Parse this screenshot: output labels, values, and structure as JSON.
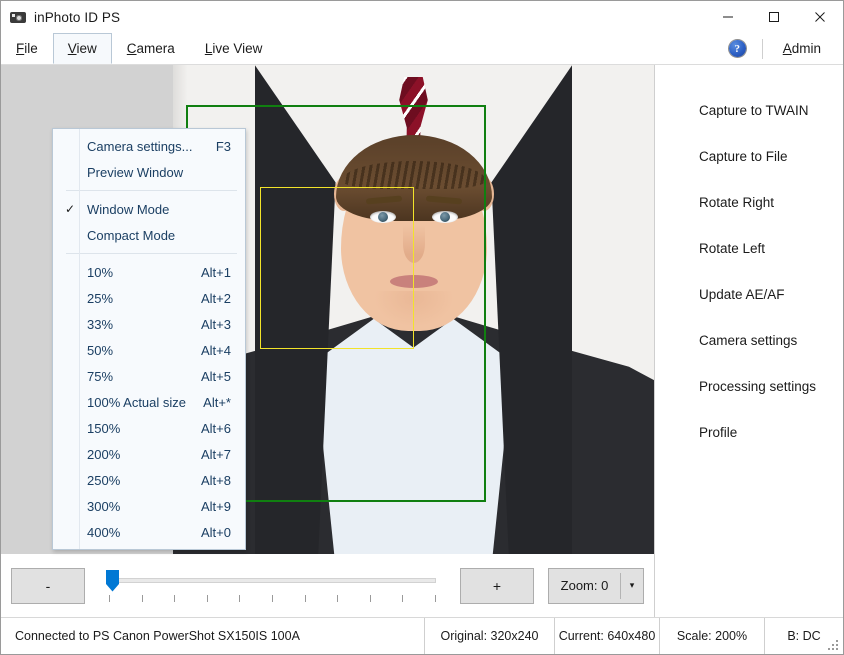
{
  "window": {
    "title": "inPhoto ID PS",
    "app_icon": "camera-icon",
    "minimize_label": "–",
    "maximize_label": "□",
    "close_label": "✕"
  },
  "menubar": {
    "items": [
      {
        "label": "File",
        "mnemonic": "F",
        "rest": "ile",
        "open": false
      },
      {
        "label": "View",
        "mnemonic": "V",
        "rest": "iew",
        "open": true
      },
      {
        "label": "Camera",
        "mnemonic": "C",
        "rest": "amera",
        "open": false
      },
      {
        "label": "Live View",
        "mnemonic": "L",
        "rest": "ive View",
        "open": false
      }
    ],
    "help_icon": "help-circle-icon",
    "help_glyph": "?",
    "admin_mnemonic": "A",
    "admin_rest": "dmin",
    "admin_label": "Admin"
  },
  "view_menu": {
    "items": [
      {
        "label": "Camera settings...",
        "accel": "F3",
        "checked": false,
        "separator_after": false
      },
      {
        "label": "Preview Window",
        "accel": "",
        "checked": false,
        "separator_after": true
      },
      {
        "label": "Window Mode",
        "accel": "",
        "checked": true,
        "separator_after": false
      },
      {
        "label": "Compact Mode",
        "accel": "",
        "checked": false,
        "separator_after": true
      },
      {
        "label": "10%",
        "accel": "Alt+1",
        "checked": false,
        "separator_after": false
      },
      {
        "label": "25%",
        "accel": "Alt+2",
        "checked": false,
        "separator_after": false
      },
      {
        "label": "33%",
        "accel": "Alt+3",
        "checked": false,
        "separator_after": false
      },
      {
        "label": "50%",
        "accel": "Alt+4",
        "checked": false,
        "separator_after": false
      },
      {
        "label": "75%",
        "accel": "Alt+5",
        "checked": false,
        "separator_after": false
      },
      {
        "label": "100% Actual size",
        "accel": "Alt+*",
        "checked": false,
        "separator_after": false
      },
      {
        "label": "150%",
        "accel": "Alt+6",
        "checked": false,
        "separator_after": false
      },
      {
        "label": "200%",
        "accel": "Alt+7",
        "checked": false,
        "separator_after": false
      },
      {
        "label": "250%",
        "accel": "Alt+8",
        "checked": false,
        "separator_after": false
      },
      {
        "label": "300%",
        "accel": "Alt+9",
        "checked": false,
        "separator_after": false
      },
      {
        "label": "400%",
        "accel": "Alt+0",
        "checked": false,
        "separator_after": false
      }
    ],
    "check_glyph": "✓"
  },
  "preview": {
    "crop_rect_color": "#107f10",
    "face_rect_color": "#f2e32a",
    "subject_description": "portrait photo of a man in a dark suit, light blue shirt and striped tie"
  },
  "controls": {
    "zoom_out_label": "-",
    "zoom_in_label": "+",
    "zoom_combo_label": "Zoom: 0",
    "zoom_combo_arrow": "▾",
    "slider_tick_count": 11,
    "slider_value_percent": 0
  },
  "sidebar": {
    "items": [
      {
        "label": "Capture to TWAIN",
        "name": "capture-to-twain"
      },
      {
        "label": "Capture to File",
        "name": "capture-to-file"
      },
      {
        "label": "Rotate Right",
        "name": "rotate-right"
      },
      {
        "label": "Rotate Left",
        "name": "rotate-left"
      },
      {
        "label": "Update AE/AF",
        "name": "update-ae-af"
      },
      {
        "label": "Camera settings",
        "name": "camera-settings"
      },
      {
        "label": "Processing settings",
        "name": "processing-settings"
      },
      {
        "label": "Profile",
        "name": "profile"
      }
    ]
  },
  "statusbar": {
    "connection": "Connected to PS Canon PowerShot SX150IS 100A",
    "original": "Original: 320x240",
    "current": "Current: 640x480",
    "scale": "Scale: 200%",
    "battery": "B: DC"
  }
}
